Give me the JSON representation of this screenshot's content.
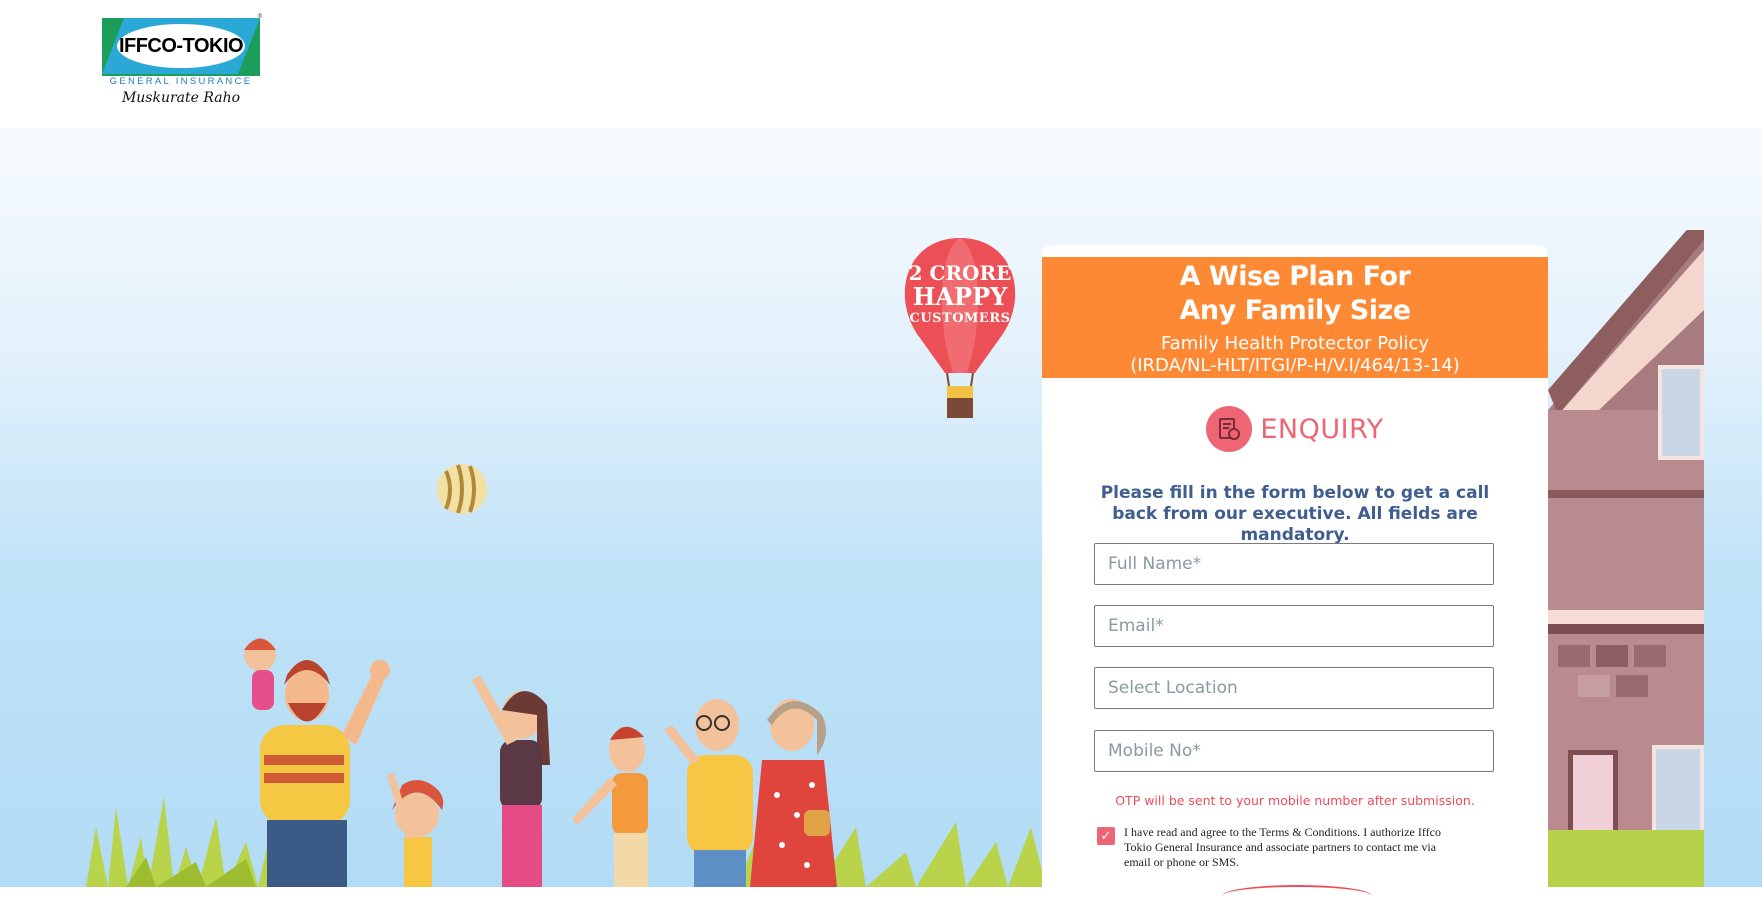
{
  "brand": {
    "logo_name": "IFFCO-TOKIO",
    "logo_sub": "GENERAL INSURANCE",
    "tagline": "Muskurate Raho"
  },
  "balloon": {
    "line1": "2 CRORE",
    "line2": "HAPPY",
    "line3": "CUSTOMERS"
  },
  "card": {
    "title_line1": "A Wise Plan For",
    "title_line2": "Any Family Size",
    "subtitle_line1": "Family Health Protector Policy",
    "subtitle_line2": "(IRDA/NL-HLT/ITGI/P-H/V.I/464/13-14)",
    "enquiry_label": "ENQUIRY",
    "instructions": "Please fill in the form below to get a call back from our executive. All fields are mandatory.",
    "fields": {
      "full_name": "Full Name*",
      "email": "Email*",
      "location": "Select Location",
      "mobile": "Mobile No*"
    },
    "otp_note": "OTP will be sent to your mobile number after submission.",
    "consent_checked": true,
    "consent_text": "I have read and agree to the Terms & Conditions. I authorize Iffco Tokio General Insurance and associate partners to contact me via email or phone or SMS."
  },
  "colors": {
    "accent_orange": "#fd8934",
    "accent_pink": "#ee6673",
    "text_blue": "#3f5d8f"
  }
}
